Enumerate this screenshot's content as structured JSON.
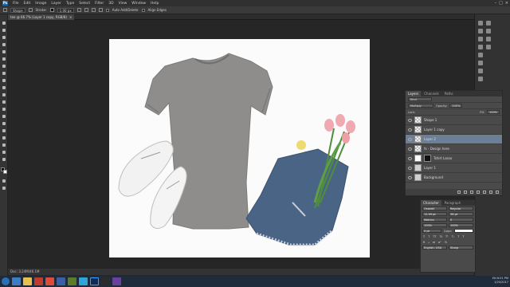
{
  "app": {
    "logo": "Ps"
  },
  "menubar": {
    "items": [
      "File",
      "Edit",
      "Image",
      "Layer",
      "Type",
      "Select",
      "Filter",
      "3D",
      "View",
      "Window",
      "Help"
    ]
  },
  "options_bar": {
    "tool_select": "Shape",
    "stroke_label": "Stroke:",
    "stroke_width": "1.00 px",
    "auto_add_label": "Auto Add/Delete",
    "align_edges_label": "Align Edges"
  },
  "document": {
    "tab_title": "tee @ 66.7% (Layer 1 copy, RGB/8)",
    "close": "×"
  },
  "status_bar": {
    "text": "Doc: 3.24M/46.1M"
  },
  "layers_panel": {
    "tabs": [
      "Layers",
      "Channels",
      "Paths"
    ],
    "blend_mode": "Multiply",
    "opacity_label": "Opacity:",
    "opacity_value": "100%",
    "lock_label": "Lock:",
    "fill_label": "Fill:",
    "fill_value": "100%",
    "layers": [
      {
        "name": "Shape 1",
        "thumb": "checker",
        "selected": false
      },
      {
        "name": "Layer 1 copy",
        "thumb": "checker",
        "selected": false
      },
      {
        "name": "Layer 2",
        "thumb": "checker",
        "selected": true
      },
      {
        "name": "fx - Design here",
        "thumb": "checker",
        "selected": false
      },
      {
        "name": "Tshirt Lasso",
        "thumb": "dark",
        "selected": false
      },
      {
        "name": "Layer 1",
        "thumb": "photo",
        "selected": false
      },
      {
        "name": "Background",
        "thumb": "photo",
        "selected": false
      }
    ]
  },
  "character_panel": {
    "tabs": [
      "Character",
      "Paragraph"
    ],
    "font": "Oswald",
    "style": "Regular",
    "size": "12.09 pt",
    "leading": "36 pt",
    "kerning": "Metrics",
    "tracking": "0",
    "vscale": "100%",
    "hscale": "100%",
    "baseline": "0 pt",
    "color_label": "Color:",
    "language": "English: USA",
    "aa": "Sharp"
  },
  "tray": {
    "time": "6:01 PM",
    "date": "1/20/2017",
    "lang": "EN"
  },
  "colors": {
    "accent": "#6d7f96",
    "canvas_bg": "#262626",
    "shirt": "#8e8d8b",
    "denim": "#4a6486",
    "tulip": "#f0a9b0",
    "leaf": "#4f8f3a"
  }
}
